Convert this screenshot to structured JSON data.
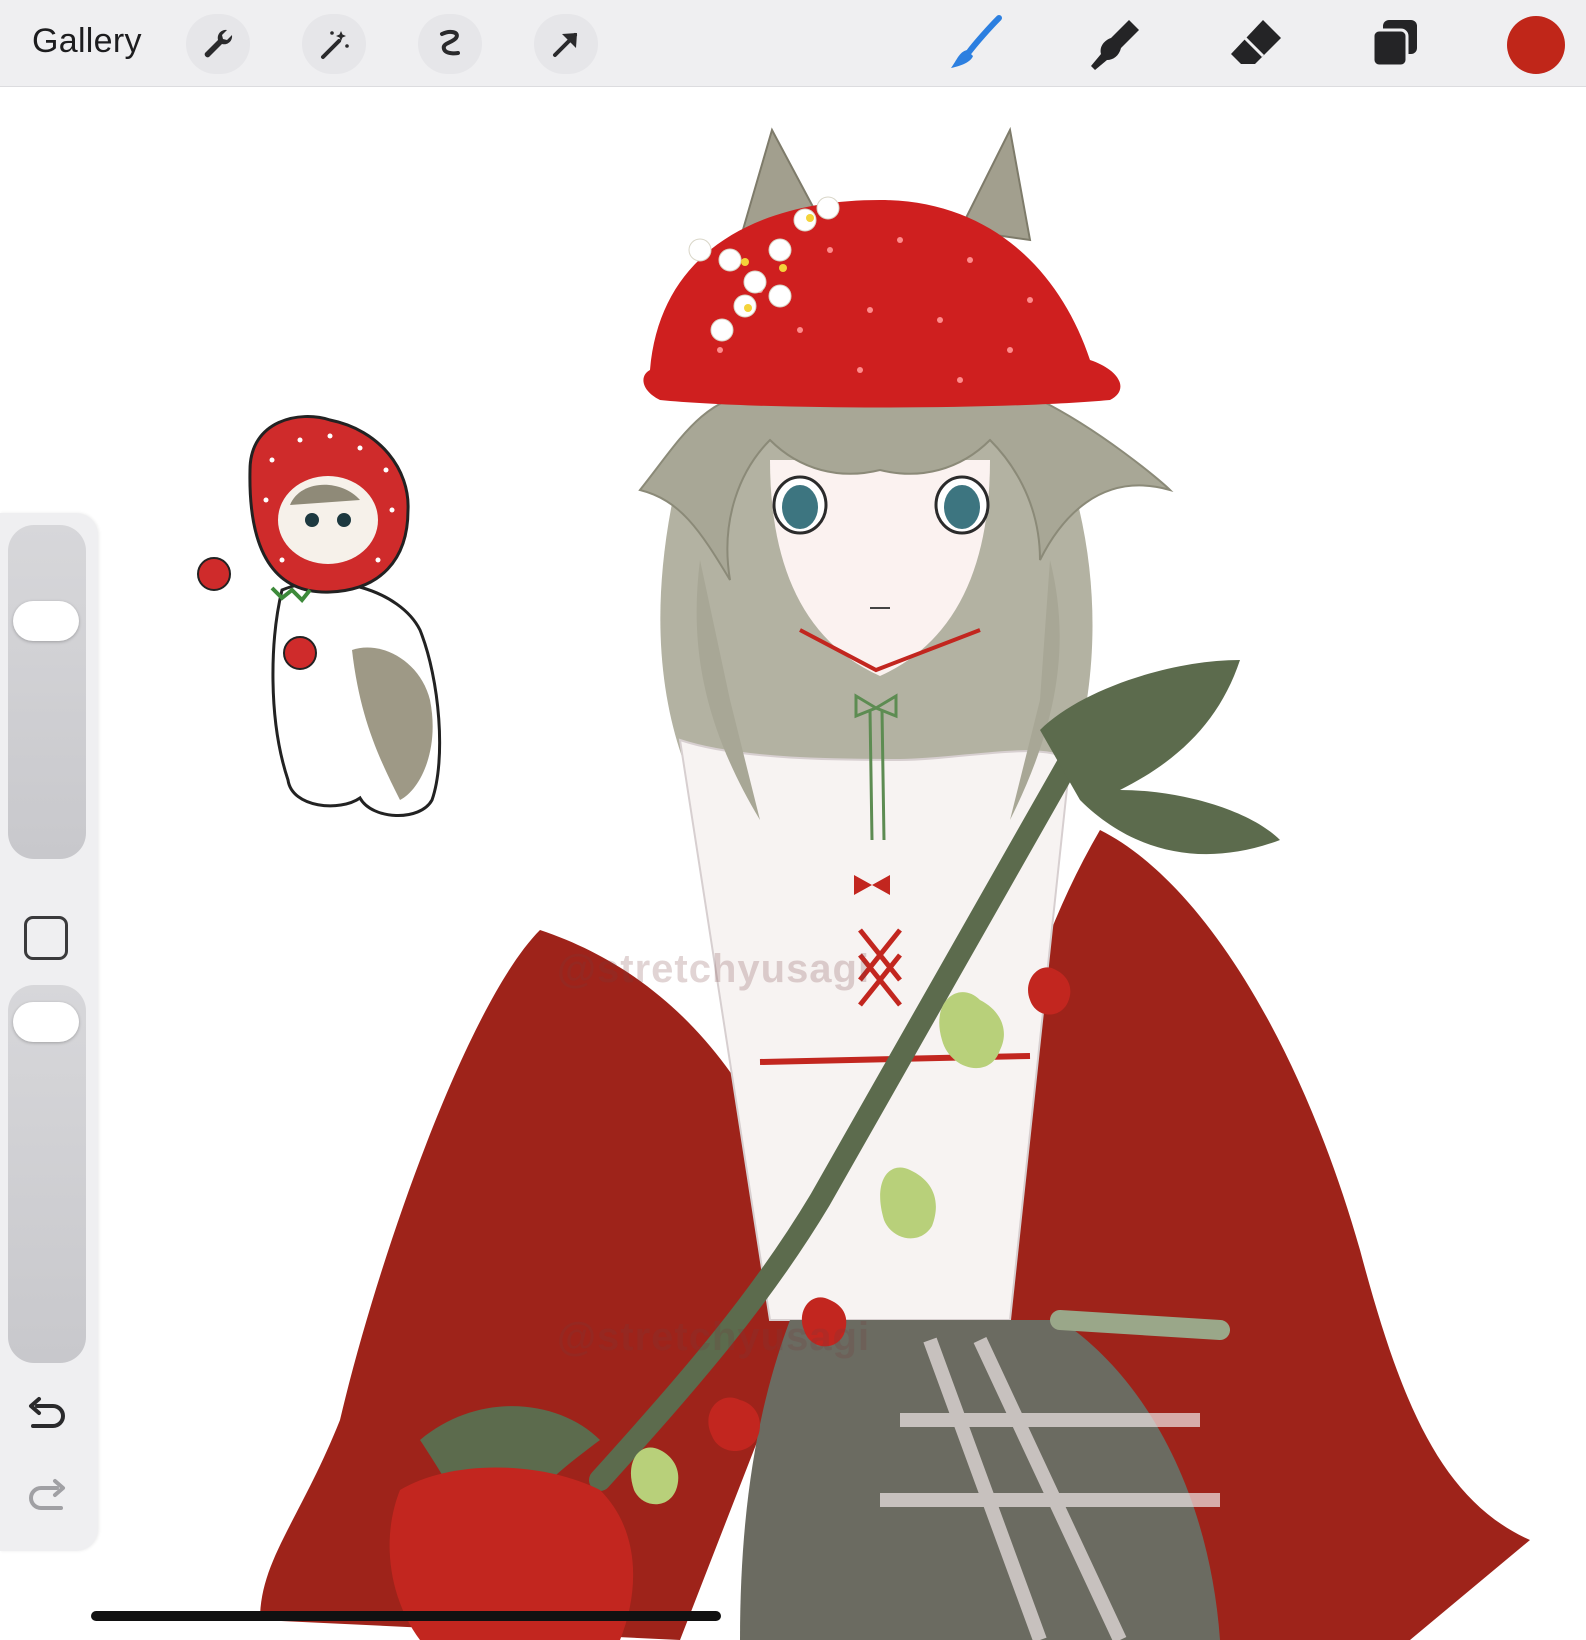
{
  "toolbar": {
    "gallery_label": "Gallery",
    "left_tools": [
      "actions-wrench",
      "adjustments-magic-wand",
      "selection",
      "transform-arrow"
    ],
    "right_tools": [
      "brush",
      "smudge",
      "eraser",
      "layers"
    ],
    "brush_active": true,
    "active_color": "#c02619"
  },
  "sidebar": {
    "brush_size_level": 0.74,
    "opacity_level": 0.95,
    "undo_icon": "undo-arrow",
    "redo_icon": "redo-arrow"
  },
  "canvas": {
    "watermarks": [
      "@stretchyusagi",
      "@stretchyusagi"
    ]
  },
  "colors": {
    "accent_blue": "#2c7fe0",
    "swatch_red": "#c02619"
  }
}
